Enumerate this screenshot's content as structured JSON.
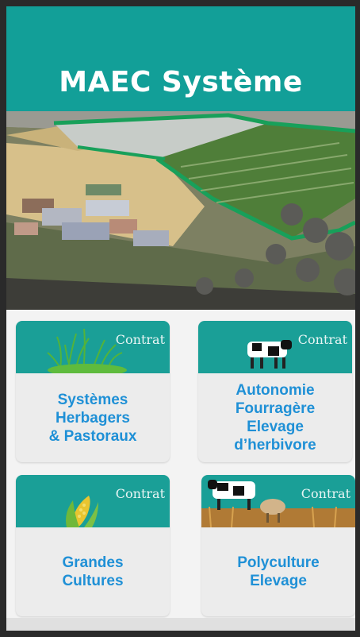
{
  "app": {
    "title": "MAEC Système"
  },
  "colors": {
    "header_bg": "#129f98",
    "card_header_bg": "#1a9f97",
    "card_label": "#1f90d6",
    "field_outline": "#18a05a"
  },
  "cards": [
    {
      "tag": "Contrat",
      "label": "Systèmes\nHerbagers\n& Pastoraux",
      "icon": "grass-icon"
    },
    {
      "tag": "Contrat",
      "label": "Autonomie\nFourragère\nElevage\nd’herbivore",
      "icon": "cow-icon"
    },
    {
      "tag": "Contrat",
      "label": "Grandes\nCultures",
      "icon": "corn-icon"
    },
    {
      "tag": "Contrat",
      "label": "Polyculture\nElevage",
      "icon": "cow-sheep-icon"
    }
  ]
}
